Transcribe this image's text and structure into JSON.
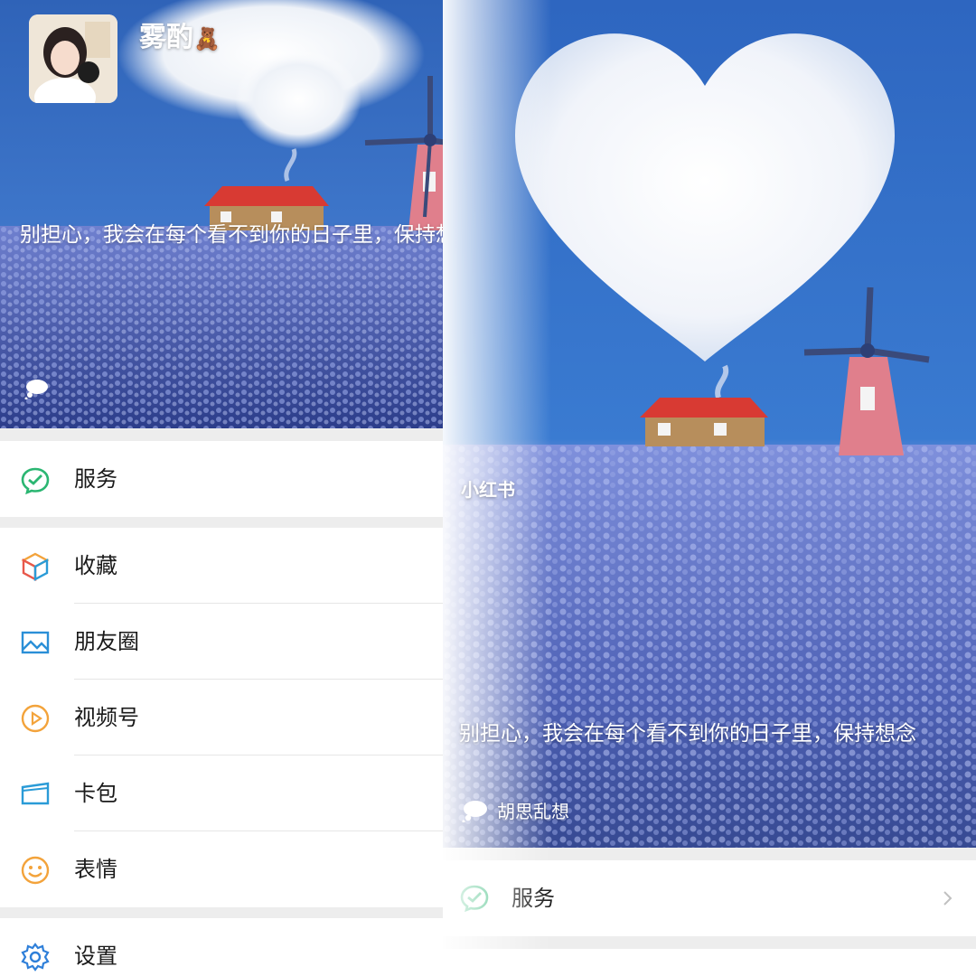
{
  "profile": {
    "nickname": "雾酌",
    "nickname_emoji": "🧸",
    "status_text": "别担心，我会在每个看不到你的日子里，保持想念"
  },
  "menu": {
    "group1": [
      {
        "label": "服务",
        "icon": "wechat-pay-icon"
      }
    ],
    "group2": [
      {
        "label": "收藏",
        "icon": "cube-icon"
      },
      {
        "label": "朋友圈",
        "icon": "image-icon"
      },
      {
        "label": "视频号",
        "icon": "play-icon"
      },
      {
        "label": "卡包",
        "icon": "card-icon"
      },
      {
        "label": "表情",
        "icon": "smile-icon"
      }
    ],
    "group3": [
      {
        "label": "设置",
        "icon": "gear-icon"
      }
    ]
  },
  "right_panel": {
    "status_text": "别担心，我会在每个看不到你的日子里，保持想念",
    "mood_label": "胡思乱想",
    "service_label": "服务",
    "watermark": "小红书"
  },
  "colors": {
    "sky": "#3f78cc",
    "field": "#5b6fbf",
    "roof": "#d83a33",
    "wechat_green": "#1aad19",
    "pay_green": "#2bb672",
    "video_orange": "#f3a33b",
    "card_blue": "#2a9bd7",
    "smile_orange": "#f3a33b",
    "gear_blue": "#2e7fd9"
  }
}
